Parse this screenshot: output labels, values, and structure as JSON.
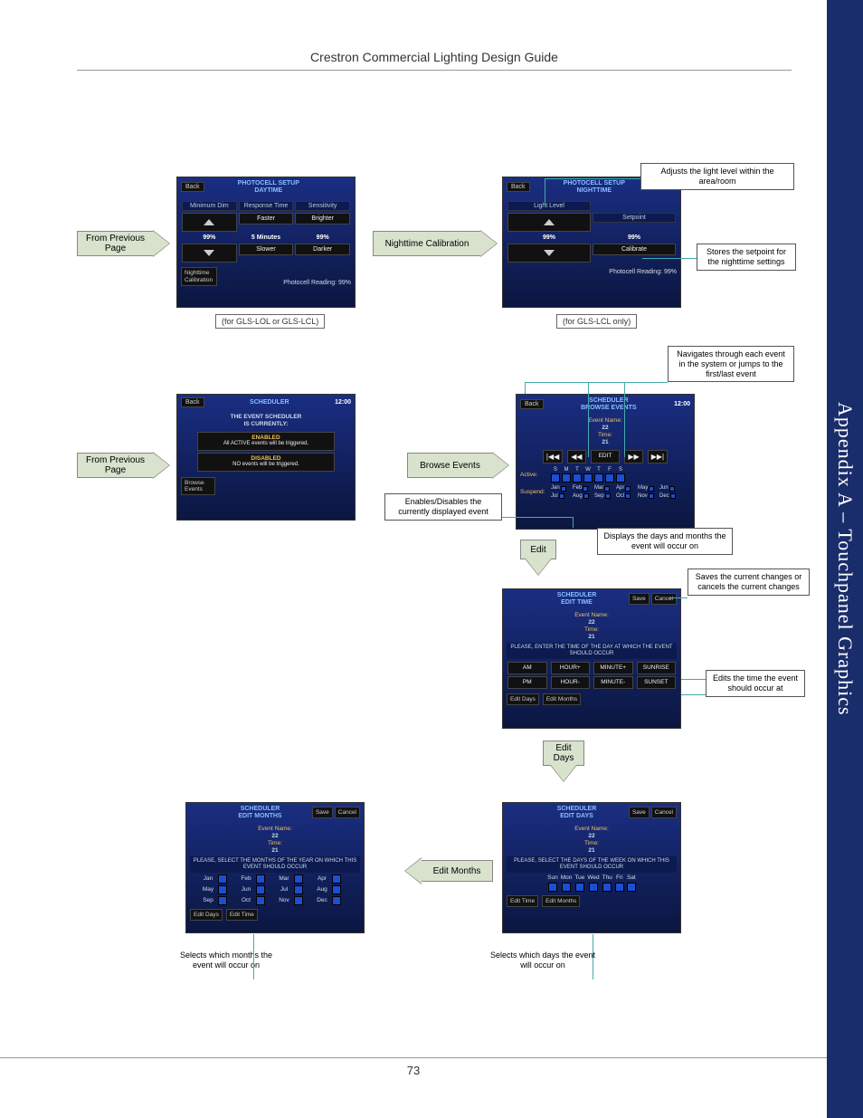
{
  "doc": {
    "header": "Crestron Commercial Lighting Design Guide",
    "sidebar": "Appendix A – Touchpanel Graphics",
    "page_number": "73"
  },
  "arrows": {
    "from_prev_1": "From Previous Page",
    "night_cal": "Nighttime Calibration",
    "from_prev_2": "From Previous Page",
    "browse_events": "Browse Events",
    "edit": "Edit",
    "edit_days": "Edit Days",
    "edit_months": "Edit Months"
  },
  "subcaps": {
    "sc1": "(for GLS-LOL or GLS-LCL)",
    "sc2": "(for GLS-LCL only)"
  },
  "callouts": {
    "adjust_light": "Adjusts the light level within the area/room",
    "store_setpoint": "Stores the setpoint for the nighttime settings",
    "nav_events": "Navigates through each event in the system or jumps to the first/last event",
    "enable_disable": "Enables/Disables the currently displayed event",
    "days_months": "Displays the days and months the event will occur on",
    "save_cancel": "Saves the current changes or cancels the current changes",
    "edits_time": "Edits the time the event should occur at",
    "sel_days": "Selects which days the event will occur on",
    "sel_months": "Selects which months the event will occur on"
  },
  "tp1": {
    "back": "Back",
    "title": "PHOTOCELL SETUP\nDAYTIME",
    "h1": "Minimum Dim",
    "h2": "Response Time",
    "h3": "Sensitivity",
    "b_fast": "Faster",
    "b_bright": "Brighter",
    "b_slow": "Slower",
    "b_dark": "Darker",
    "v1": "99%",
    "v2": "5 Minutes",
    "v3": "99%",
    "tab": "Nighttime Calibration",
    "footer": "Photocell Reading:  99%"
  },
  "tp2": {
    "back": "Back",
    "title": "PHOTOCELL SETUP\nNIGHTTIME",
    "h1": "Light Level",
    "h2": "Setpoint",
    "v1": "99%",
    "v2": "99%",
    "cal": "Calibrate",
    "footer": "Photocell Reading:  99%"
  },
  "tp3": {
    "back": "Back",
    "title": "SCHEDULER",
    "time": "12:00",
    "line1": "THE EVENT SCHEDULER",
    "line2": "IS CURRENTLY:",
    "en_t": "ENABLED",
    "en_d": "All ACTIVE events will be triggered.",
    "dis_t": "DISABLED",
    "dis_d": "NO events will be triggered.",
    "tab": "Browse Events"
  },
  "tp4": {
    "back": "Back",
    "title": "SCHEDULER\nBROWSE EVENTS",
    "time": "12:00",
    "eventlabel": "Event Name:",
    "event": "22",
    "timelabel": "Time:",
    "timeval": "21",
    "edit": "EDIT",
    "active": "Active:",
    "suspend": "Suspend:",
    "days": [
      "S",
      "M",
      "T",
      "W",
      "T",
      "F",
      "S"
    ],
    "months": [
      "Jan",
      "Feb",
      "Mar",
      "Apr",
      "May",
      "Jun",
      "Jul",
      "Aug",
      "Sep",
      "Oct",
      "Nov",
      "Dec"
    ]
  },
  "tp5": {
    "title": "SCHEDULER\nEDIT TIME",
    "save": "Save",
    "cancel": "Cancel",
    "eventlabel": "Event Name:",
    "event": "22",
    "timelabel": "Time:",
    "timeval": "21",
    "instr": "PLEASE, ENTER THE TIME OF THE DAY AT WHICH THE EVENT SHOULD OCCUR",
    "am": "AM",
    "pm": "PM",
    "hp": "HOUR+",
    "hm": "HOUR-",
    "mp": "MINUTE+",
    "mm": "MINUTE-",
    "sr": "SUNRISE",
    "ss": "SUNSET",
    "tab1": "Edit Days",
    "tab2": "Edit Months"
  },
  "tp6": {
    "title": "SCHEDULER\nEDIT DAYS",
    "save": "Save",
    "cancel": "Cancel",
    "eventlabel": "Event Name:",
    "event": "22",
    "timelabel": "Time:",
    "timeval": "21",
    "instr": "PLEASE, SELECT THE DAYS OF THE WEEK ON WHICH THIS EVENT SHOULD OCCUR",
    "days": [
      "Sun",
      "Mon",
      "Tue",
      "Wed",
      "Thu",
      "Fri",
      "Sat"
    ],
    "tab1": "Edit Time",
    "tab2": "Edit Months"
  },
  "tp7": {
    "title": "SCHEDULER\nEDIT MONTHS",
    "save": "Save",
    "cancel": "Cancel",
    "eventlabel": "Event Name:",
    "event": "22",
    "timelabel": "Time:",
    "timeval": "21",
    "instr": "PLEASE, SELECT THE MONTHS OF THE YEAR ON WHICH THIS EVENT SHOULD OCCUR",
    "months": [
      "Jan",
      "Feb",
      "Mar",
      "Apr",
      "May",
      "Jun",
      "Jul",
      "Aug",
      "Sep",
      "Oct",
      "Nov",
      "Dec"
    ],
    "tab1": "Edit Days",
    "tab2": "Edit Time"
  }
}
